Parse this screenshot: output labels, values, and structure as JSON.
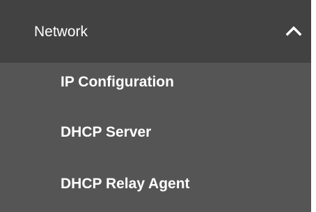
{
  "nav": {
    "section_label": "Network",
    "expanded_icon": "chevron-up-icon",
    "items": [
      {
        "label": "IP Configuration"
      },
      {
        "label": "DHCP Server"
      },
      {
        "label": "DHCP Relay Agent"
      }
    ]
  },
  "colors": {
    "header_bg": "#424242",
    "panel_bg": "#555555",
    "text": "#ffffff"
  }
}
